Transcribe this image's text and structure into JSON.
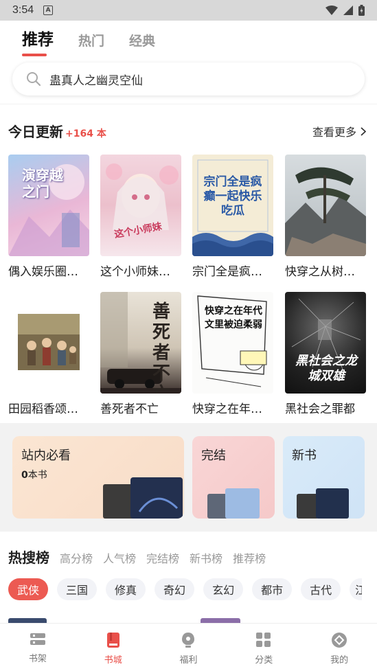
{
  "status_bar": {
    "time": "3:54",
    "notification_letter": "A"
  },
  "tabs": [
    {
      "label": "推荐",
      "active": true
    },
    {
      "label": "热门",
      "active": false
    },
    {
      "label": "经典",
      "active": false
    }
  ],
  "search": {
    "value": "蛊真人之幽灵空仙",
    "icon": "search-icon"
  },
  "today_update": {
    "title": "今日更新",
    "count": "+164 本",
    "see_more": "查看更多"
  },
  "books": [
    {
      "title": "偶入娱乐圈…",
      "cover_text": "演穿越之门"
    },
    {
      "title": "这个小师妹…",
      "cover_text": "这个小师妹"
    },
    {
      "title": "宗门全是疯…",
      "cover_text": "宗门全是疯癫一起快乐吃瓜"
    },
    {
      "title": "快穿之从树…",
      "cover_text": ""
    },
    {
      "title": "田园稻香颂…",
      "cover_text": ""
    },
    {
      "title": "善死者不亡",
      "cover_text": "善死者不亡"
    },
    {
      "title": "快穿之在年…",
      "cover_text": "快穿之在年代文里被迫柔弱"
    },
    {
      "title": "黑社会之罪都",
      "cover_text": "黑社会之龙城双雄"
    }
  ],
  "feature_cards": [
    {
      "title": "站内必看",
      "sub_count": "0",
      "sub_unit": "本书",
      "bg": "#fae3cf"
    },
    {
      "title": "完结",
      "bg": "#f8d3d3"
    },
    {
      "title": "新书",
      "bg": "#d5e8f8"
    }
  ],
  "ranking": {
    "tabs": [
      "热搜榜",
      "高分榜",
      "人气榜",
      "完结榜",
      "新书榜",
      "推荐榜"
    ],
    "chips": [
      "武侠",
      "三国",
      "修真",
      "奇幻",
      "玄幻",
      "都市",
      "古代",
      "江"
    ]
  },
  "bottom_nav": [
    {
      "label": "书架",
      "icon": "bookshelf-icon",
      "active": false
    },
    {
      "label": "书城",
      "icon": "bookstore-icon",
      "active": true
    },
    {
      "label": "福利",
      "icon": "welfare-icon",
      "active": false
    },
    {
      "label": "分类",
      "icon": "category-icon",
      "active": false
    },
    {
      "label": "我的",
      "icon": "profile-icon",
      "active": false
    }
  ],
  "colors": {
    "accent": "#e9504a"
  }
}
